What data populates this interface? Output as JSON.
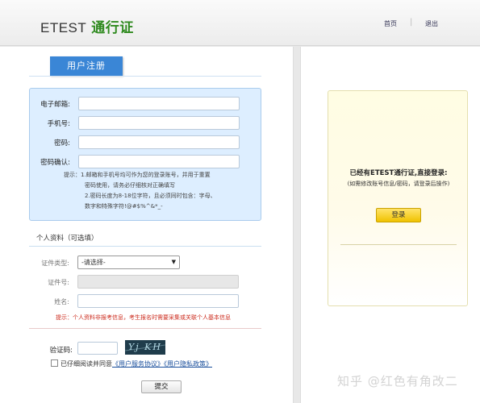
{
  "header": {
    "logo_en": "ETEST",
    "logo_cn": "通行证",
    "nav_home": "首页",
    "nav_separator": "|",
    "nav_logout": "退出"
  },
  "register": {
    "tab_label": "用户注册",
    "fields": [
      {
        "label": "电子邮箱:",
        "value": ""
      },
      {
        "label": "手机号:",
        "value": ""
      },
      {
        "label": "密码:",
        "value": ""
      },
      {
        "label": "密码确认:",
        "value": ""
      }
    ],
    "hints": [
      "提示：1.邮箱和手机号均可作为您的登录账号，并用于重置",
      "密码使用，请务必仔细核对正确填写",
      "2.密码长度为8-18位字符，且必须同时包含：字母、",
      "数字和特殊字符!@#$%^&*_-"
    ]
  },
  "personal": {
    "section_title": "个人资料（可选填）",
    "id_type_label": "证件类型:",
    "id_type_value": "-请选择-",
    "id_number_label": "证件号:",
    "name_label": "姓名:",
    "warning": "提示：个人资料非报考信息，考生报名时需要采集或关联个人基本信息"
  },
  "captcha": {
    "label": "验证码:",
    "image_text": "Yj KH",
    "agree_prefix": "已仔细阅读并同意",
    "terms_link": "《用户服务协议》",
    "privacy_link": "《用户隐私政策》"
  },
  "submit_label": "提交",
  "login": {
    "title": "已经有ETEST通行证,直接登录:",
    "subtitle": "(如需修改账号信息/密码，请登录后操作)",
    "button_label": "登录"
  },
  "watermark": "知乎 @红色有角改二",
  "colors": {
    "logo_accent": "#2f8a1f",
    "tab_blue": "#3a86d6",
    "warning_red": "#cc2b1d",
    "login_button": "#f0c200",
    "link_blue": "#1a4f9c"
  }
}
